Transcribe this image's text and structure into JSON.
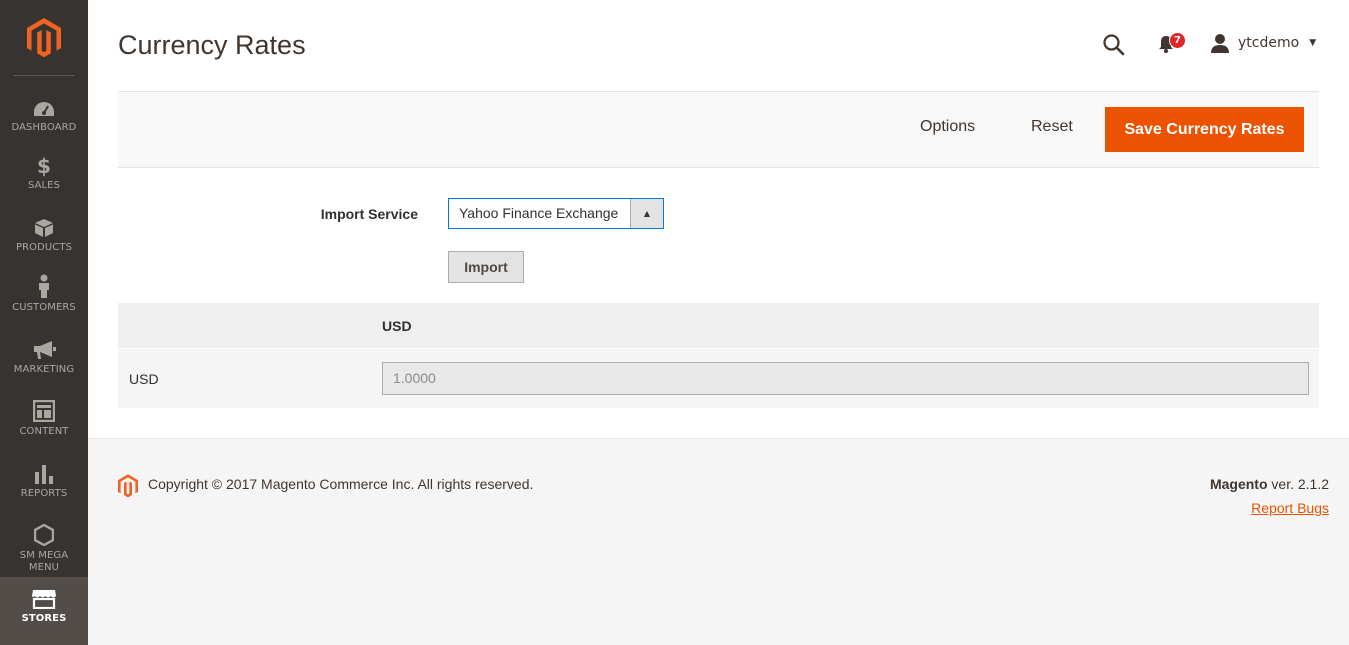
{
  "page": {
    "title": "Currency Rates"
  },
  "colors": {
    "accent": "#eb5202",
    "sidebar": "#373330",
    "badge": "#e22626",
    "focus_border": "#007bdb"
  },
  "sidebar": {
    "items": [
      {
        "label": "DASHBOARD",
        "icon": "dashboard-icon"
      },
      {
        "label": "SALES",
        "icon": "dollar-icon"
      },
      {
        "label": "PRODUCTS",
        "icon": "box-icon"
      },
      {
        "label": "CUSTOMERS",
        "icon": "person-icon"
      },
      {
        "label": "MARKETING",
        "icon": "megaphone-icon"
      },
      {
        "label": "CONTENT",
        "icon": "layout-icon"
      },
      {
        "label": "REPORTS",
        "icon": "bar-chart-icon"
      },
      {
        "label": "SM MEGA MENU",
        "icon": "hexagon-icon"
      },
      {
        "label": "STORES",
        "icon": "storefront-icon",
        "active": true
      }
    ]
  },
  "header": {
    "notifications_count": "7",
    "username": "ytcdemo"
  },
  "actions": {
    "options_label": "Options",
    "reset_label": "Reset",
    "save_label": "Save Currency Rates"
  },
  "form": {
    "import_service_label": "Import Service",
    "import_service_value": "Yahoo Finance Exchange",
    "import_button_label": "Import"
  },
  "rates_table": {
    "column_header": "USD",
    "rows": [
      {
        "currency": "USD",
        "rate": "1.0000"
      }
    ]
  },
  "footer": {
    "copyright": "Copyright © 2017 Magento Commerce Inc. All rights reserved.",
    "brand": "Magento",
    "version": "ver. 2.1.2",
    "report_bugs": "Report Bugs"
  }
}
